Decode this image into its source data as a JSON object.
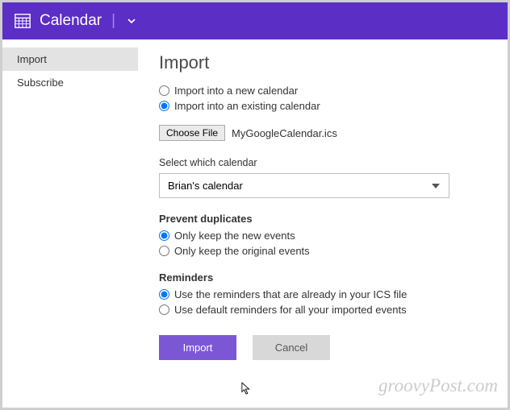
{
  "header": {
    "title": "Calendar"
  },
  "sidebar": {
    "items": [
      {
        "label": "Import",
        "active": true
      },
      {
        "label": "Subscribe",
        "active": false
      }
    ]
  },
  "main": {
    "heading": "Import",
    "importTarget": {
      "options": [
        {
          "label": "Import into a new calendar",
          "checked": false
        },
        {
          "label": "Import into an existing calendar",
          "checked": true
        }
      ]
    },
    "fileChooser": {
      "button": "Choose File",
      "filename": "MyGoogleCalendar.ics"
    },
    "calendarSelect": {
      "label": "Select which calendar",
      "value": "Brian's calendar"
    },
    "duplicates": {
      "heading": "Prevent duplicates",
      "options": [
        {
          "label": "Only keep the new events",
          "checked": true
        },
        {
          "label": "Only keep the original events",
          "checked": false
        }
      ]
    },
    "reminders": {
      "heading": "Reminders",
      "options": [
        {
          "label": "Use the reminders that are already in your ICS file",
          "checked": true
        },
        {
          "label": "Use default reminders for all your imported events",
          "checked": false
        }
      ]
    },
    "buttons": {
      "primary": "Import",
      "secondary": "Cancel"
    }
  },
  "watermark": "groovyPost.com"
}
